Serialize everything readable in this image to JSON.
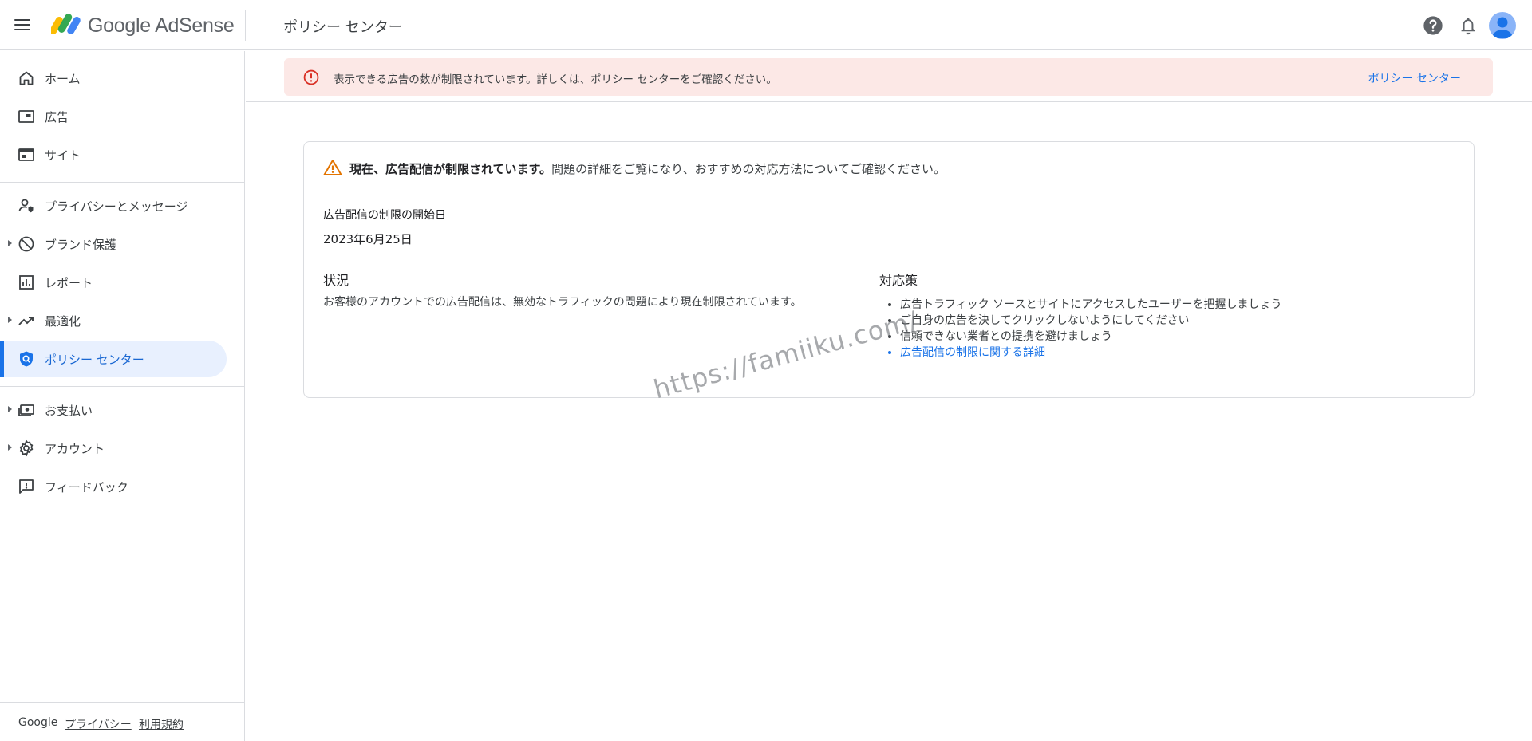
{
  "app": {
    "brand": "Google AdSense"
  },
  "header": {
    "page_title": "ポリシー センター"
  },
  "sidebar": {
    "items": [
      {
        "label": "ホーム",
        "icon": "home-icon"
      },
      {
        "label": "広告",
        "icon": "ads-icon"
      },
      {
        "label": "サイト",
        "icon": "sites-icon"
      },
      {
        "label": "プライバシーとメッセージ",
        "icon": "privacy-messaging-icon"
      },
      {
        "label": "ブランド保護",
        "icon": "block-icon"
      },
      {
        "label": "レポート",
        "icon": "bar-chart-icon"
      },
      {
        "label": "最適化",
        "icon": "trending-up-icon"
      },
      {
        "label": "ポリシー センター",
        "icon": "policy-shield-icon",
        "active": true
      },
      {
        "label": "お支払い",
        "icon": "payments-icon"
      },
      {
        "label": "アカウント",
        "icon": "gear-icon"
      },
      {
        "label": "フィードバック",
        "icon": "feedback-icon"
      }
    ],
    "footer": {
      "google": "Google",
      "privacy": "プライバシー",
      "terms": "利用規約"
    }
  },
  "banner": {
    "text": "表示できる広告の数が制限されています。詳しくは、ポリシー センターをご確認ください。",
    "link": "ポリシー センター",
    "color": "#fce8e6"
  },
  "card": {
    "warning_bold": "現在、広告配信が制限されています。",
    "warning_rest": "問題の詳細をご覧になり、おすすめの対応方法についてご確認ください。",
    "start_label": "広告配信の制限の開始日",
    "start_date": "2023年6月25日",
    "status_heading": "状況",
    "status_text": "お客様のアカウントでの広告配信は、無効なトラフィックの問題により現在制限されています。",
    "action_heading": "対応策",
    "actions": [
      "広告トラフィック ソースとサイトにアクセスしたユーザーを把握しましょう",
      "ご自身の広告を決してクリックしないようにしてください",
      "信頼できない業者との提携を避けましょう",
      "広告配信の制限に関する詳細"
    ]
  },
  "watermark": "https://famiiku.com/",
  "colors": {
    "accent": "#1a73e8",
    "error": "#d93025",
    "warning": "#e37400"
  }
}
